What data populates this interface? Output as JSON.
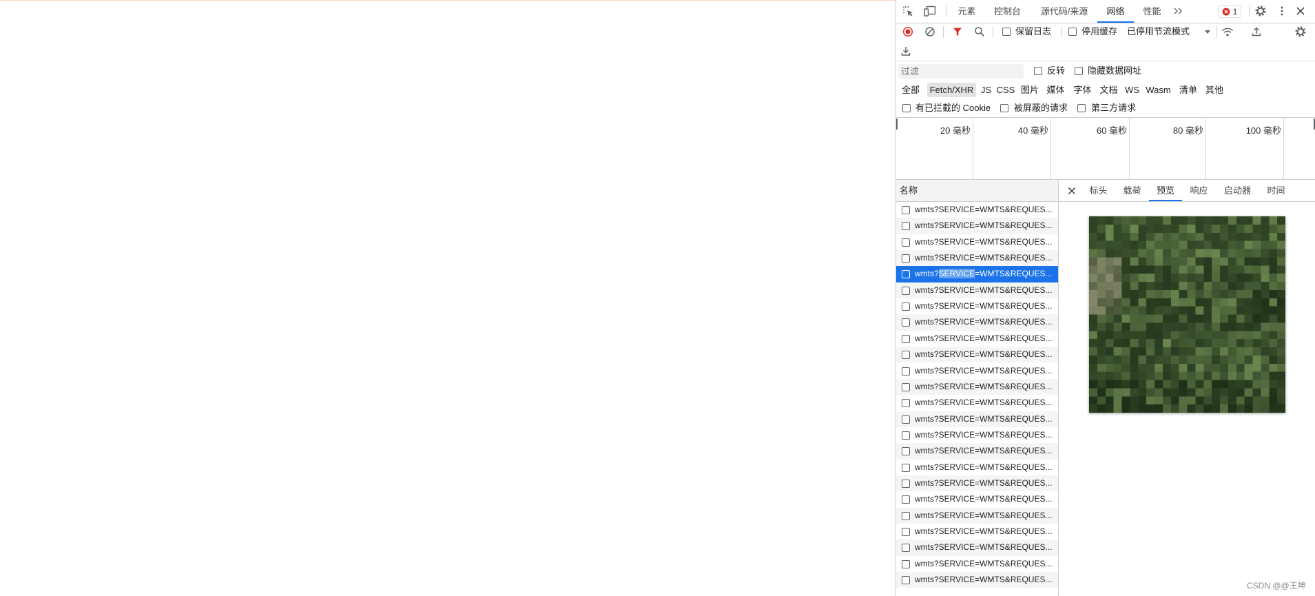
{
  "colors": {
    "accent": "#1a73e8",
    "record": "#d93025",
    "filter_active": "#d93025",
    "selected_row": "#1a73e8",
    "error": "#d93025"
  },
  "icons": [
    "inspect-icon",
    "device-toolbar-icon",
    "chevron-double-right-icon",
    "error-icon",
    "gear-icon",
    "more-vertical-icon",
    "close-icon",
    "record-stop-icon",
    "clear-icon",
    "filter-icon",
    "search-icon",
    "chevron-down-icon",
    "network-conditions-icon",
    "upload-icon",
    "download-icon"
  ],
  "devtools": {
    "main_tabs": [
      "元素",
      "控制台",
      "源代码/来源",
      "网络",
      "性能"
    ],
    "active_main_tab_index": 3,
    "error_count": "1"
  },
  "network_toolbar": {
    "recording": true,
    "preserve_log_label": "保留日志",
    "preserve_log_checked": false,
    "disable_cache_label": "停用缓存",
    "disable_cache_checked": false,
    "throttling_value": "已停用节流模式"
  },
  "filter_bar": {
    "placeholder": "过滤",
    "value": "",
    "invert_label": "反转",
    "hide_data_urls_label": "隐藏数据网址",
    "types": [
      "全部",
      "Fetch/XHR",
      "JS",
      "CSS",
      "图片",
      "媒体",
      "字体",
      "文档",
      "WS",
      "Wasm",
      "清单",
      "其他"
    ],
    "active_type_index": 1,
    "blocked_cookies_label": "有已拦截的 Cookie",
    "blocked_requests_label": "被屏蔽的请求",
    "third_party_label": "第三方请求"
  },
  "overview": {
    "ticks": [
      "20 毫秒",
      "40 毫秒",
      "60 毫秒",
      "80 毫秒",
      "100 毫秒"
    ]
  },
  "requests": {
    "column_header": "名称",
    "rows": [
      "wmts?SERVICE=WMTS&REQUES...",
      "wmts?SERVICE=WMTS&REQUES...",
      "wmts?SERVICE=WMTS&REQUES...",
      "wmts?SERVICE=WMTS&REQUES...",
      "wmts?SERVICE=WMTS&REQUES...",
      "wmts?SERVICE=WMTS&REQUES...",
      "wmts?SERVICE=WMTS&REQUES...",
      "wmts?SERVICE=WMTS&REQUES...",
      "wmts?SERVICE=WMTS&REQUES...",
      "wmts?SERVICE=WMTS&REQUES...",
      "wmts?SERVICE=WMTS&REQUES...",
      "wmts?SERVICE=WMTS&REQUES...",
      "wmts?SERVICE=WMTS&REQUES...",
      "wmts?SERVICE=WMTS&REQUES...",
      "wmts?SERVICE=WMTS&REQUES...",
      "wmts?SERVICE=WMTS&REQUES...",
      "wmts?SERVICE=WMTS&REQUES...",
      "wmts?SERVICE=WMTS&REQUES...",
      "wmts?SERVICE=WMTS&REQUES...",
      "wmts?SERVICE=WMTS&REQUES...",
      "wmts?SERVICE=WMTS&REQUES...",
      "wmts?SERVICE=WMTS&REQUES...",
      "wmts?SERVICE=WMTS&REQUES...",
      "wmts?SERVICE=WMTS&REQUES..."
    ],
    "selected_index": 4,
    "selected_highlight": {
      "start": 5,
      "end": 12
    }
  },
  "details": {
    "tabs": [
      "标头",
      "载荷",
      "预览",
      "响应",
      "启动器",
      "时间"
    ],
    "active_tab_index": 2
  },
  "watermark": "CSDN @@王坤"
}
